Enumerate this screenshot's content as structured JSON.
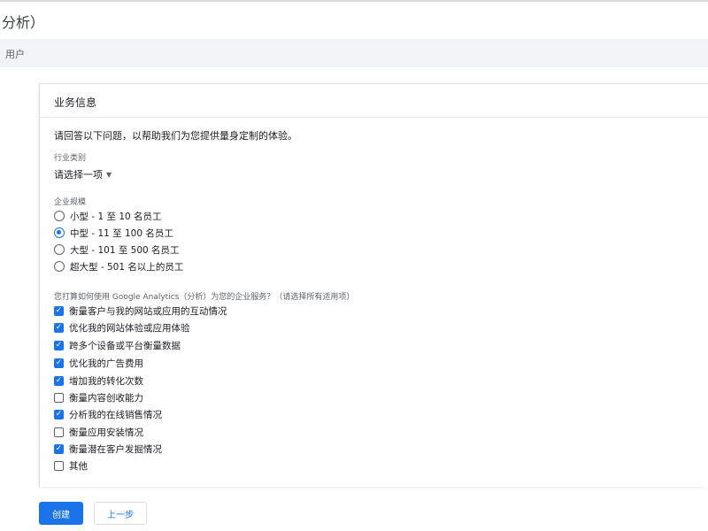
{
  "header": {
    "title": "分析）",
    "breadcrumb": "用户"
  },
  "card": {
    "title": "业务信息",
    "intro": "请回答以下问题，以帮助我们为您提供量身定制的体验。",
    "industry": {
      "label": "行业类别",
      "value": "请选择一项"
    },
    "size": {
      "label": "企业规模",
      "options": [
        {
          "label": "小型 - 1 至 10 名员工",
          "selected": false
        },
        {
          "label": "中型 - 11 至 100 名员工",
          "selected": true
        },
        {
          "label": "大型 - 101 至 500 名员工",
          "selected": false
        },
        {
          "label": "超大型 - 501 名以上的员工",
          "selected": false
        }
      ]
    },
    "usage": {
      "label": "您打算如何使用 Google Analytics（分析）为您的企业服务？（请选择所有适用项）",
      "options": [
        {
          "label": "衡量客户与我的网站或应用的互动情况",
          "checked": true
        },
        {
          "label": "优化我的网站体验或应用体验",
          "checked": true
        },
        {
          "label": "跨多个设备或平台衡量数据",
          "checked": true
        },
        {
          "label": "优化我的广告费用",
          "checked": true
        },
        {
          "label": "增加我的转化次数",
          "checked": true
        },
        {
          "label": "衡量内容创收能力",
          "checked": false
        },
        {
          "label": "分析我的在线销售情况",
          "checked": true
        },
        {
          "label": "衡量应用安装情况",
          "checked": false
        },
        {
          "label": "衡量潜在客户发掘情况",
          "checked": true
        },
        {
          "label": "其他",
          "checked": false
        }
      ]
    }
  },
  "buttons": {
    "create": "创建",
    "back": "上一步"
  },
  "colors": {
    "accent": "#1a73e8"
  }
}
